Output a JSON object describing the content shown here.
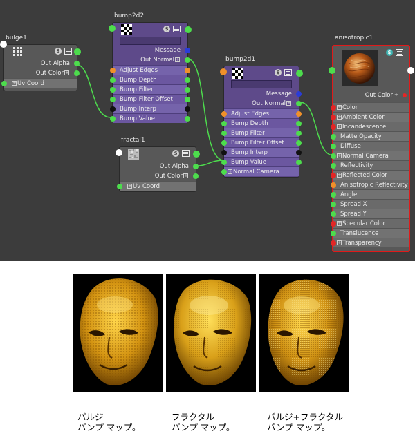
{
  "editor": {
    "nodes": {
      "bulge": {
        "title": "bulge1",
        "outputs": [
          "Out Alpha",
          "Out Color"
        ],
        "inputs": [
          "Uv Coord"
        ]
      },
      "bump2d2": {
        "title": "bump2d2",
        "outputs": [
          "Message",
          "Out Normal"
        ],
        "inputs": [
          "Adjust Edges",
          "Bump Depth",
          "Bump Filter",
          "Bump Filter Offset",
          "Bump Interp",
          "Bump Value"
        ]
      },
      "fractal": {
        "title": "fractal1",
        "outputs": [
          "Out Alpha",
          "Out Color"
        ],
        "inputs": [
          "Uv Coord"
        ]
      },
      "bump2d1": {
        "title": "bump2d1",
        "outputs": [
          "Message",
          "Out Normal"
        ],
        "inputs": [
          "Adjust Edges",
          "Bump Depth",
          "Bump Filter",
          "Bump Filter Offset",
          "Bump Interp",
          "Bump Value",
          "Normal Camera"
        ]
      },
      "anisotropic": {
        "title": "anisotropic1",
        "outputs": [
          "Out Color"
        ],
        "inputs": [
          "Color",
          "Ambient Color",
          "Incandescence",
          "Matte Opacity",
          "Diffuse",
          "Normal Camera",
          "Reflectivity",
          "Reflected Color",
          "Anisotropic Reflectivity",
          "Angle",
          "Spread X",
          "Spread Y",
          "Specular Color",
          "Translucence",
          "Transparency"
        ]
      }
    },
    "header_glyph": "$",
    "colors": {
      "background": "#3c3c3c",
      "node": "#585858",
      "bump_node": "#5e4a8a",
      "selected_border": "#e01a1a",
      "wire": "#4ddc4d"
    }
  },
  "captions": [
    {
      "line1": "バルジ",
      "line2": "バンプ マップ。"
    },
    {
      "line1": "フラクタル",
      "line2": "バンプ マップ。"
    },
    {
      "line1": "バルジ+フラクタル",
      "line2": "バンプ マップ。"
    }
  ]
}
